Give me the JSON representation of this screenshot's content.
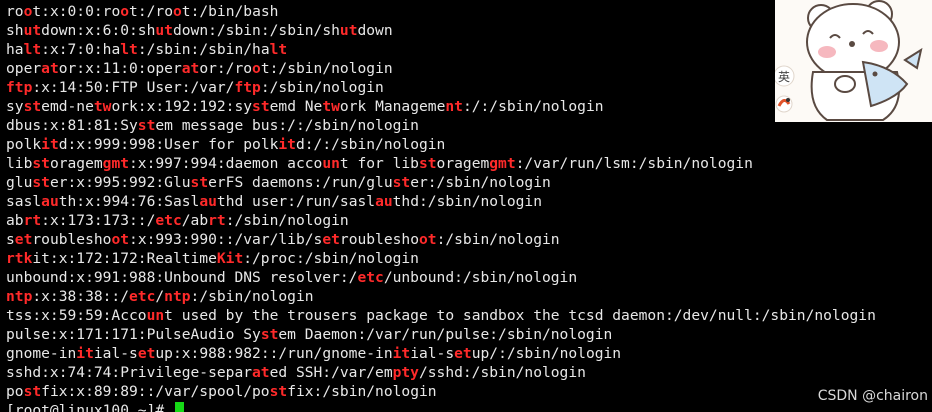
{
  "terminal": {
    "lines": [
      [
        {
          "t": "ro"
        },
        {
          "t": "o",
          "h": 1
        },
        {
          "t": "t:x:0:0:ro"
        },
        {
          "t": "o",
          "h": 1
        },
        {
          "t": "t:/ro"
        },
        {
          "t": "o",
          "h": 1
        },
        {
          "t": "t:/bin/bash"
        }
      ],
      [
        {
          "t": "sh"
        },
        {
          "t": "ut",
          "h": 1
        },
        {
          "t": "down:x:6:0:sh"
        },
        {
          "t": "ut",
          "h": 1
        },
        {
          "t": "down:/sbin:/sbin/sh"
        },
        {
          "t": "ut",
          "h": 1
        },
        {
          "t": "down"
        }
      ],
      [
        {
          "t": "ha"
        },
        {
          "t": "lt",
          "h": 1
        },
        {
          "t": ":x:7:0:ha"
        },
        {
          "t": "lt",
          "h": 1
        },
        {
          "t": ":/sbin:/sbin/ha"
        },
        {
          "t": "lt",
          "h": 1
        }
      ],
      [
        {
          "t": "oper"
        },
        {
          "t": "at",
          "h": 1
        },
        {
          "t": "or:x:11:0:oper"
        },
        {
          "t": "at",
          "h": 1
        },
        {
          "t": "or:/ro"
        },
        {
          "t": "o",
          "h": 1
        },
        {
          "t": "t:/sbin/nologin"
        }
      ],
      [
        {
          "t": "ftp",
          "h": 1
        },
        {
          "t": ":x:14:50:FTP User:/var/"
        },
        {
          "t": "ftp",
          "h": 1
        },
        {
          "t": ":/sbin/nologin"
        }
      ],
      [
        {
          "t": "sy"
        },
        {
          "t": "st",
          "h": 1
        },
        {
          "t": "emd-ne"
        },
        {
          "t": "tw",
          "h": 1
        },
        {
          "t": "ork:x:192:192:sy"
        },
        {
          "t": "st",
          "h": 1
        },
        {
          "t": "emd Ne"
        },
        {
          "t": "tw",
          "h": 1
        },
        {
          "t": "ork Manageme"
        },
        {
          "t": "nt",
          "h": 1
        },
        {
          "t": ":/:/sbin/nologin"
        }
      ],
      [
        {
          "t": "dbus:x:81:81:Sy"
        },
        {
          "t": "st",
          "h": 1
        },
        {
          "t": "em message bus:/:/sbin/nologin"
        }
      ],
      [
        {
          "t": "polk"
        },
        {
          "t": "it",
          "h": 1
        },
        {
          "t": "d:x:999:998:User for polk"
        },
        {
          "t": "it",
          "h": 1
        },
        {
          "t": "d:/:/sbin/nologin"
        }
      ],
      [
        {
          "t": "lib"
        },
        {
          "t": "st",
          "h": 1
        },
        {
          "t": "oragem"
        },
        {
          "t": "gmt",
          "h": 1
        },
        {
          "t": ":x:997:994:daemon acco"
        },
        {
          "t": "un",
          "h": 1
        },
        {
          "t": "t for lib"
        },
        {
          "t": "st",
          "h": 1
        },
        {
          "t": "oragem"
        },
        {
          "t": "gmt",
          "h": 1
        },
        {
          "t": ":/var/run/lsm:/sbin/nologin"
        }
      ],
      [
        {
          "t": "glu"
        },
        {
          "t": "st",
          "h": 1
        },
        {
          "t": "er:x:995:992:Glu"
        },
        {
          "t": "st",
          "h": 1
        },
        {
          "t": "erFS daemons:/run/glu"
        },
        {
          "t": "st",
          "h": 1
        },
        {
          "t": "er:/sbin/nologin"
        }
      ],
      [
        {
          "t": "sasl"
        },
        {
          "t": "au",
          "h": 1
        },
        {
          "t": "th:x:994:76:Sasl"
        },
        {
          "t": "au",
          "h": 1
        },
        {
          "t": "thd user:/run/sasl"
        },
        {
          "t": "au",
          "h": 1
        },
        {
          "t": "thd:/sbin/nologin"
        }
      ],
      [
        {
          "t": "ab"
        },
        {
          "t": "rt",
          "h": 1
        },
        {
          "t": ":x:173:173::/"
        },
        {
          "t": "etc",
          "h": 1
        },
        {
          "t": "/ab"
        },
        {
          "t": "rt",
          "h": 1
        },
        {
          "t": ":/sbin/nologin"
        }
      ],
      [
        {
          "t": "s"
        },
        {
          "t": "et",
          "h": 1
        },
        {
          "t": "roublesho"
        },
        {
          "t": "ot",
          "h": 1
        },
        {
          "t": ":x:993:990::/var/lib/s"
        },
        {
          "t": "et",
          "h": 1
        },
        {
          "t": "roublesho"
        },
        {
          "t": "ot",
          "h": 1
        },
        {
          "t": ":/sbin/nologin"
        }
      ],
      [
        {
          "t": "rtk",
          "h": 1
        },
        {
          "t": "it:x:172:172:Realtime"
        },
        {
          "t": "Kit",
          "h": 1
        },
        {
          "t": ":/proc:/sbin/nologin"
        }
      ],
      [
        {
          "t": "unbound:x:991:988:Unbound DNS resolver:/"
        },
        {
          "t": "etc",
          "h": 1
        },
        {
          "t": "/unbound:/sbin/nologin"
        }
      ],
      [
        {
          "t": "ntp",
          "h": 1
        },
        {
          "t": ":x:38:38::/"
        },
        {
          "t": "etc",
          "h": 1
        },
        {
          "t": "/"
        },
        {
          "t": "ntp",
          "h": 1
        },
        {
          "t": ":/sbin/nologin"
        }
      ],
      [
        {
          "t": "tss:x:59:59:Acco"
        },
        {
          "t": "un",
          "h": 1
        },
        {
          "t": "t used by the trousers package to sandbox the tcsd daemon:/dev/null:/sbin/nologin"
        }
      ],
      [
        {
          "t": "pulse:x:171:171:PulseAudio Sy"
        },
        {
          "t": "st",
          "h": 1
        },
        {
          "t": "em Daemon:/var/run/pulse:/sbin/nologin"
        }
      ],
      [
        {
          "t": "gnome-in"
        },
        {
          "t": "it",
          "h": 1
        },
        {
          "t": "ial-s"
        },
        {
          "t": "et",
          "h": 1
        },
        {
          "t": "up:x:988:982::/run/gnome-in"
        },
        {
          "t": "it",
          "h": 1
        },
        {
          "t": "ial-s"
        },
        {
          "t": "et",
          "h": 1
        },
        {
          "t": "up/:/sbin/nologin"
        }
      ],
      [
        {
          "t": "sshd:x:74:74:Privilege-separ"
        },
        {
          "t": "at",
          "h": 1
        },
        {
          "t": "ed SSH:/var/em"
        },
        {
          "t": "pty",
          "h": 1
        },
        {
          "t": "/sshd:/sbin/nologin"
        }
      ],
      [
        {
          "t": "po"
        },
        {
          "t": "st",
          "h": 1
        },
        {
          "t": "fix:x:89:89::/var/spool/po"
        },
        {
          "t": "st",
          "h": 1
        },
        {
          "t": "fix:/sbin/nologin"
        }
      ]
    ],
    "prompt": "[root@linux100 ~]# ",
    "highlight_color": "#ff2a2a",
    "cursor_color": "#16d916",
    "text_color": "#e8e8e8",
    "background_color": "#000000"
  },
  "watermark": "CSDN @chairon",
  "sticker": {
    "badge_text": "英",
    "icon": "bear-with-fish-sticker"
  }
}
